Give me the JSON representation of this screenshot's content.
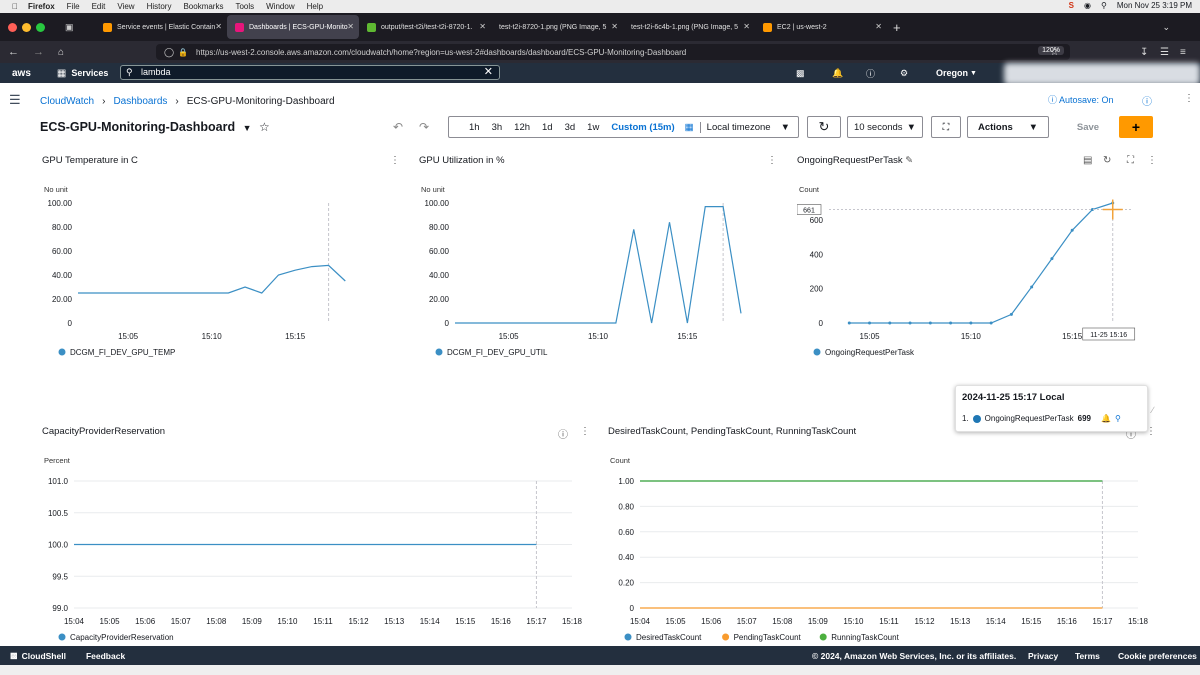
{
  "macos": {
    "browser": "Firefox",
    "menus": [
      "File",
      "Edit",
      "View",
      "History",
      "Bookmarks",
      "Tools",
      "Window",
      "Help"
    ],
    "clock": "Mon Nov 25  3:19 PM"
  },
  "tabs": [
    {
      "label": "Service events | Elastic Contain",
      "color": "#ff9900"
    },
    {
      "label": "Dashboards | ECS-GPU-Monito",
      "color": "#e7157b",
      "active": true
    },
    {
      "label": "output/test-t2i/test-t2i-8720-1.",
      "color": "#5fb832"
    },
    {
      "label": "test-t2i-8720-1.png (PNG Image, 5",
      "color": ""
    },
    {
      "label": "test-t2i-6c4b-1.png (PNG Image, 5",
      "color": ""
    },
    {
      "label": "EC2 | us-west-2",
      "color": "#ff9900"
    }
  ],
  "url": "https://us-west-2.console.aws.amazon.com/cloudwatch/home?region=us-west-2#dashboards/dashboard/ECS-GPU-Monitoring-Dashboard",
  "zoom": "120%",
  "aws": {
    "logo": "aws",
    "services": "Services",
    "search_value": "lambda",
    "region": "Oregon",
    "autosave": "Autosave: On"
  },
  "breadcrumb": {
    "root": "CloudWatch",
    "parent": "Dashboards",
    "current": "ECS-GPU-Monitoring-Dashboard"
  },
  "dashboard_title": "ECS-GPU-Monitoring-Dashboard",
  "toolbar": {
    "ranges": [
      "1h",
      "3h",
      "12h",
      "1d",
      "3d",
      "1w"
    ],
    "custom": "Custom (15m)",
    "timezone": "Local timezone",
    "refresh": "10 seconds",
    "actions": "Actions",
    "save": "Save",
    "add": "+"
  },
  "footer": {
    "cloudshell": "CloudShell",
    "feedback": "Feedback",
    "copyright": "© 2024, Amazon Web Services, Inc. or its affiliates.",
    "privacy": "Privacy",
    "terms": "Terms",
    "cookies": "Cookie preferences"
  },
  "tooltip": {
    "title": "2024-11-25 15:17 Local",
    "index": "1.",
    "series": "OngoingRequestPerTask",
    "value": "699",
    "color": "#1f77b4"
  },
  "colors": {
    "blue": "#3b8fc4",
    "orange": "#f89b2e",
    "green": "#4caf3e",
    "accent": "#ff9900",
    "link": "#0972d3"
  },
  "chart_data": [
    {
      "type": "line",
      "title": "GPU Temperature in C",
      "ylabel": "No unit",
      "ylim": [
        0,
        100
      ],
      "yticks": [
        "0",
        "20.00",
        "40.00",
        "60.00",
        "80.00",
        "100.00"
      ],
      "xticks": [
        "15:05",
        "15:10",
        "15:15"
      ],
      "series": [
        {
          "name": "DCGM_FI_DEV_GPU_TEMP",
          "color": "#3b8fc4",
          "x": [
            "15:02",
            "15:03",
            "15:04",
            "15:05",
            "15:06",
            "15:07",
            "15:08",
            "15:09",
            "15:10",
            "15:11",
            "15:12",
            "15:13",
            "15:14",
            "15:15",
            "15:16",
            "15:17",
            "15:18"
          ],
          "values": [
            25,
            25,
            25,
            25,
            25,
            25,
            25,
            25,
            25,
            25,
            30,
            25,
            40,
            44,
            47,
            48,
            35
          ]
        }
      ]
    },
    {
      "type": "line",
      "title": "GPU Utilization in %",
      "ylabel": "No unit",
      "ylim": [
        0,
        100
      ],
      "yticks": [
        "0",
        "20.00",
        "40.00",
        "60.00",
        "80.00",
        "100.00"
      ],
      "xticks": [
        "15:05",
        "15:10",
        "15:15"
      ],
      "series": [
        {
          "name": "DCGM_FI_DEV_GPU_UTIL",
          "color": "#3b8fc4",
          "x": [
            "15:02",
            "15:03",
            "15:04",
            "15:05",
            "15:06",
            "15:07",
            "15:08",
            "15:09",
            "15:10",
            "15:11",
            "15:12",
            "15:13",
            "15:14",
            "15:15",
            "15:16",
            "15:17",
            "15:18"
          ],
          "values": [
            0,
            0,
            0,
            0,
            0,
            0,
            0,
            0,
            0,
            0,
            78,
            0,
            84,
            0,
            97,
            97,
            8
          ]
        }
      ]
    },
    {
      "type": "line",
      "title": "OngoingRequestPerTask",
      "ylabel": "Count",
      "ylim": [
        0,
        699
      ],
      "yticks": [
        "0",
        "200",
        "400",
        "600"
      ],
      "xticks": [
        "15:05",
        "15:10",
        "15:15"
      ],
      "annotation": "661",
      "hover_label": "11-25 15:16",
      "series": [
        {
          "name": "OngoingRequestPerTask",
          "color": "#3b8fc4",
          "x": [
            "15:04",
            "15:05",
            "15:06",
            "15:07",
            "15:08",
            "15:09",
            "15:10",
            "15:11",
            "15:12",
            "15:13",
            "15:14",
            "15:15",
            "15:16",
            "15:17"
          ],
          "values": [
            0,
            0,
            0,
            0,
            0,
            0,
            0,
            0,
            50,
            210,
            375,
            540,
            661,
            699
          ]
        }
      ]
    },
    {
      "type": "line",
      "title": "CapacityProviderReservation",
      "ylabel": "Percent",
      "ylim": [
        99,
        101
      ],
      "yticks": [
        "99.0",
        "99.5",
        "100.0",
        "100.5",
        "101.0"
      ],
      "xticks": [
        "15:04",
        "15:05",
        "15:06",
        "15:07",
        "15:08",
        "15:09",
        "15:10",
        "15:11",
        "15:12",
        "15:13",
        "15:14",
        "15:15",
        "15:16",
        "15:17",
        "15:18"
      ],
      "series": [
        {
          "name": "CapacityProviderReservation",
          "color": "#3b8fc4",
          "x": [
            "15:04",
            "15:17"
          ],
          "values": [
            100,
            100
          ]
        }
      ]
    },
    {
      "type": "line",
      "title": "DesiredTaskCount, PendingTaskCount, RunningTaskCount",
      "ylabel": "Count",
      "ylim": [
        0,
        1
      ],
      "yticks": [
        "0",
        "0.20",
        "0.40",
        "0.60",
        "0.80",
        "1.00"
      ],
      "xticks": [
        "15:04",
        "15:05",
        "15:06",
        "15:07",
        "15:08",
        "15:09",
        "15:10",
        "15:11",
        "15:12",
        "15:13",
        "15:14",
        "15:15",
        "15:16",
        "15:17",
        "15:18"
      ],
      "series": [
        {
          "name": "DesiredTaskCount",
          "color": "#3b8fc4",
          "x": [
            "15:04",
            "15:17"
          ],
          "values": [
            1,
            1
          ]
        },
        {
          "name": "PendingTaskCount",
          "color": "#f89b2e",
          "x": [
            "15:04",
            "15:17"
          ],
          "values": [
            0,
            0
          ]
        },
        {
          "name": "RunningTaskCount",
          "color": "#4caf3e",
          "x": [
            "15:04",
            "15:17"
          ],
          "values": [
            1,
            1
          ]
        }
      ]
    }
  ]
}
